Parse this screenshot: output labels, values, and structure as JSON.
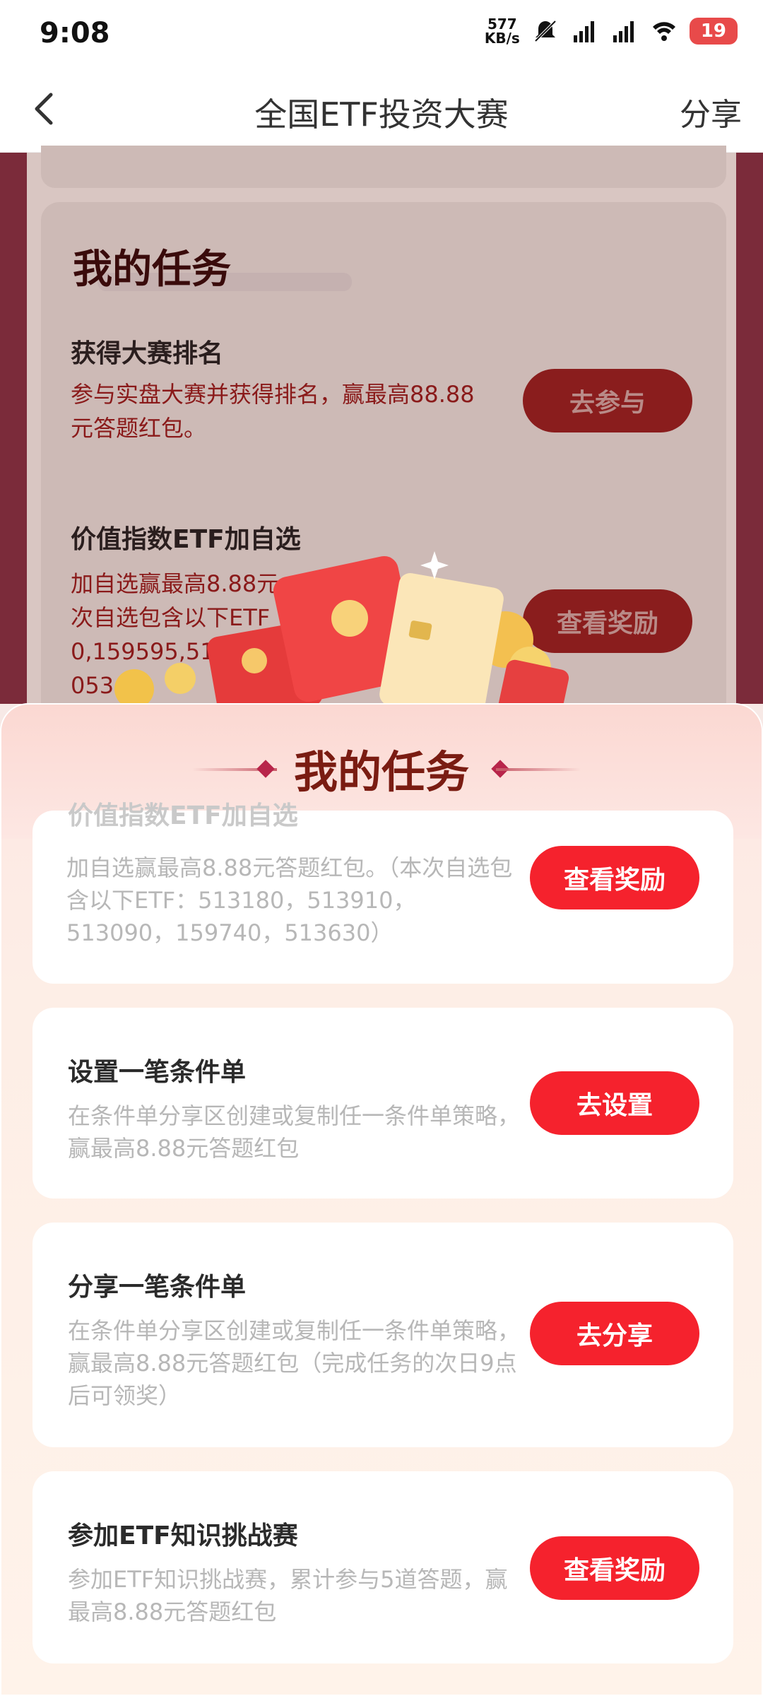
{
  "status_bar": {
    "time": "9:08",
    "net_speed_top": "577",
    "net_speed_bottom": "KB/s",
    "battery": "19"
  },
  "header": {
    "title": "全国ETF投资大赛",
    "share_label": "分享"
  },
  "background_panel": {
    "section_title": "我的任务",
    "tasks": [
      {
        "title": "获得大赛排名",
        "description": "参与实盘大赛并获得排名，赢最高88.88元答题红包。",
        "button": "去参与"
      },
      {
        "title": "价值指数ETF加自选",
        "description_line1": "加自选赢最高8.88元",
        "description_line2": "次自选包含以下ETF",
        "description_line3": "0,159595,513",
        "description_line4": "053",
        "button": "查看奖励"
      }
    ]
  },
  "sheet": {
    "title": "我的任务",
    "tasks": [
      {
        "title": "价值指数ETF加自选",
        "description": "加自选赢最高8.88元答题红包。（本次自选包含以下ETF：513180，513910，513090，159740，513630）",
        "button": "查看奖励"
      },
      {
        "title": "设置一笔条件单",
        "description": "在条件单分享区创建或复制任一条件单策略，赢最高8.88元答题红包",
        "button": "去设置"
      },
      {
        "title": "分享一笔条件单",
        "description": "在条件单分享区创建或复制任一条件单策略，赢最高8.88元答题红包（完成任务的次日9点后可领奖）",
        "button": "去分享"
      },
      {
        "title": "参加ETF知识挑战赛",
        "description": "参加ETF知识挑战赛，累计参与5道答题，赢最高8.88元答题红包",
        "button": "查看奖励"
      }
    ]
  },
  "colors": {
    "accent_red": "#f5222d",
    "title_dark_red": "#7a1c12"
  }
}
